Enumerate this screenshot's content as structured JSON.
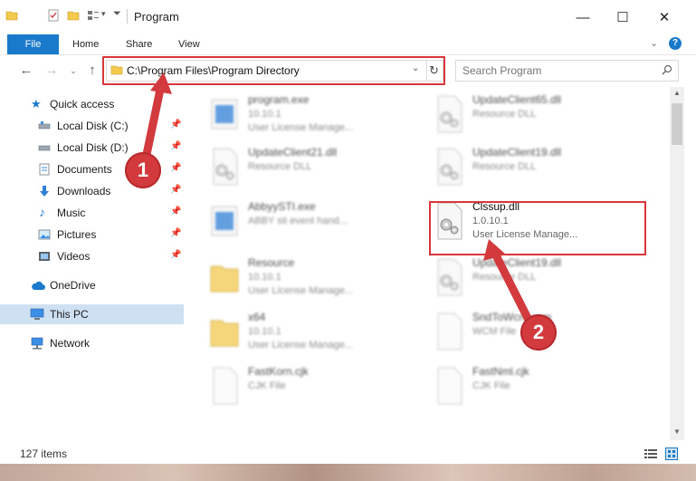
{
  "window": {
    "title": "Program",
    "controls": {
      "minimize": "—",
      "maximize": "☐",
      "close": "✕"
    }
  },
  "ribbon": {
    "file": "File",
    "tabs": [
      "Home",
      "Share",
      "View"
    ],
    "help": "?"
  },
  "address": {
    "path": "C:\\Program Files\\Program Directory",
    "search_placeholder": "Search Program"
  },
  "nav": {
    "quick_access": "Quick access",
    "items": [
      {
        "label": "Local Disk (C:)",
        "icon": "drive-icon"
      },
      {
        "label": "Local Disk (D:)",
        "icon": "drive-icon"
      },
      {
        "label": "Documents",
        "icon": "documents-icon"
      },
      {
        "label": "Downloads",
        "icon": "downloads-icon"
      },
      {
        "label": "Music",
        "icon": "music-icon"
      },
      {
        "label": "Pictures",
        "icon": "pictures-icon"
      },
      {
        "label": "Videos",
        "icon": "videos-icon"
      }
    ],
    "onedrive": "OneDrive",
    "this_pc": "This PC",
    "network": "Network"
  },
  "files": [
    {
      "name": "program.exe",
      "line2": "10.10.1",
      "line3": "User License Manage...",
      "icon": "exe-icon",
      "col": 0,
      "row": 0
    },
    {
      "name": "UpdateClient65.dll",
      "line2": "Resource DLL",
      "line3": "",
      "icon": "dll-icon",
      "col": 1,
      "row": 0
    },
    {
      "name": "UpdateClient21.dll",
      "line2": "Resource DLL",
      "line3": "",
      "icon": "dll-icon",
      "col": 0,
      "row": 1
    },
    {
      "name": "UpdateClient19.dll",
      "line2": "Resource DLL",
      "line3": "",
      "icon": "dll-icon",
      "col": 1,
      "row": 1
    },
    {
      "name": "AbbyySTI.exe",
      "line2": "ABBY sti event hand...",
      "line3": "",
      "icon": "exe-icon",
      "col": 0,
      "row": 2
    },
    {
      "name": "Clssup.dll",
      "line2": "1.0.10.1",
      "line3": "User License Manage...",
      "icon": "dll-icon",
      "col": 1,
      "row": 2,
      "focus": true
    },
    {
      "name": "Resource",
      "line2": "10.10.1",
      "line3": "User License Manage...",
      "icon": "folder-icon",
      "col": 0,
      "row": 3
    },
    {
      "name": "UpdateClient19.dll",
      "line2": "Resource DLL",
      "line3": "",
      "icon": "dll-icon",
      "col": 1,
      "row": 3
    },
    {
      "name": "x64",
      "line2": "10.10.1",
      "line3": "User License Manage...",
      "icon": "folder-icon",
      "col": 0,
      "row": 4
    },
    {
      "name": "SndToWcm.com",
      "line2": "WCM File",
      "line3": "",
      "icon": "generic-icon",
      "col": 1,
      "row": 4
    },
    {
      "name": "FastKorn.cjk",
      "line2": "CJK File",
      "line3": "",
      "icon": "generic-icon",
      "col": 0,
      "row": 5
    },
    {
      "name": "FastNml.cjk",
      "line2": "CJK File",
      "line3": "",
      "icon": "generic-icon",
      "col": 1,
      "row": 5
    }
  ],
  "status": {
    "items": "127 items"
  },
  "callouts": {
    "one": "1",
    "two": "2"
  },
  "colors": {
    "accent": "#1979ca",
    "highlight": "#d9363b",
    "selection": "#cde1f3"
  }
}
